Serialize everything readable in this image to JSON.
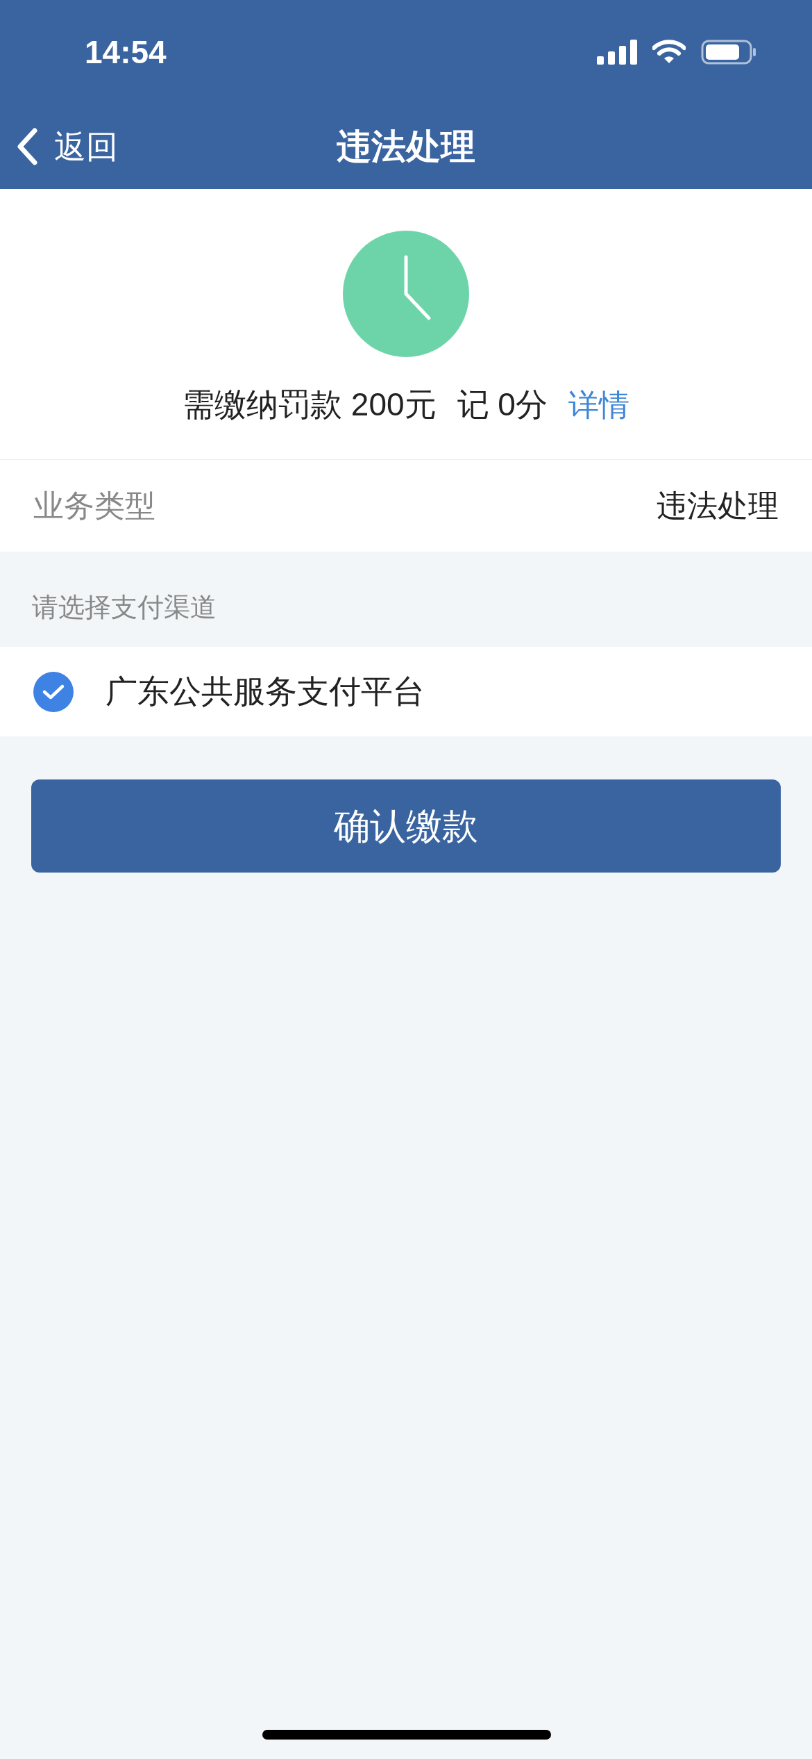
{
  "status_bar": {
    "time": "14:54"
  },
  "nav": {
    "back": "返回",
    "title": "违法处理"
  },
  "summary": {
    "fine": "需缴纳罚款 200元",
    "points": "记 0分",
    "link": "详情"
  },
  "fields": [
    {
      "label": "业务类型",
      "value": "违法处理"
    }
  ],
  "payment": {
    "heading": "请选择支付渠道",
    "options": [
      {
        "label": "广东公共服务支付平台",
        "selected": true
      }
    ]
  },
  "confirm_button": "确认缴款"
}
